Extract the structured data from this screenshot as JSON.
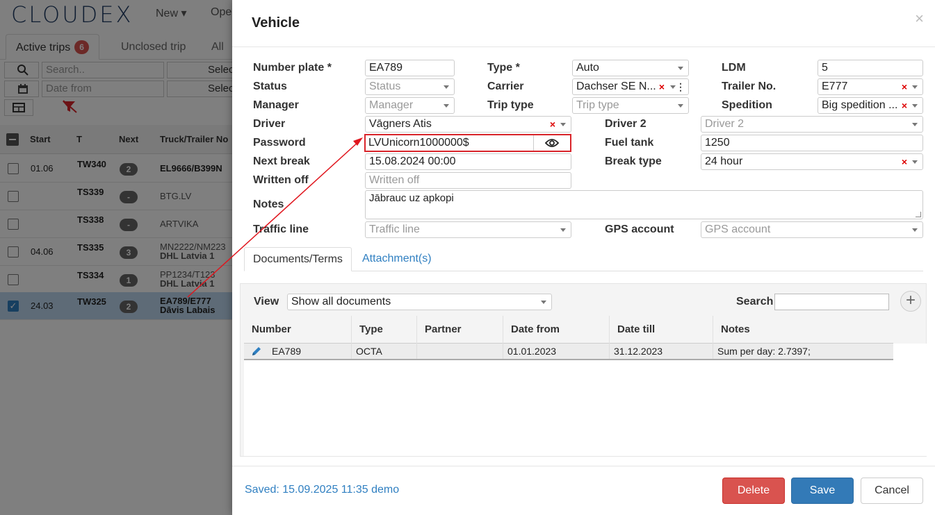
{
  "app": {
    "logo": "CLOUDEX",
    "nav": [
      "New ▾",
      "Ope"
    ],
    "tabs": {
      "active_label": "Active trips",
      "active_count": "6",
      "unclosed_label": "Unclosed trip",
      "all_label": "All t"
    },
    "filters": {
      "search_placeholder": "Search..",
      "date_placeholder": "Date from",
      "select1": "Selec",
      "select2": "Selec"
    },
    "table_headers": [
      "Start",
      "T",
      "Next",
      "Truck/Trailer No"
    ],
    "rows": [
      {
        "date": "01.06",
        "trip": "TW340",
        "count": "2",
        "truck": "EL9666/B399N",
        "truck2": ""
      },
      {
        "date": "",
        "trip": "TS339",
        "count": "-",
        "truck": "BTG.LV",
        "truck2": ""
      },
      {
        "date": "",
        "trip": "TS338",
        "count": "-",
        "truck": "ARTVIKA",
        "truck2": ""
      },
      {
        "date": "04.06",
        "trip": "TS335",
        "count": "3",
        "truck": "MN2222/NM223",
        "truck2": "DHL Latvia 1"
      },
      {
        "date": "",
        "trip": "TS334",
        "count": "1",
        "truck": "PP1234/T123",
        "truck2": "DHL Latvia 1"
      },
      {
        "date": "24.03",
        "trip": "TW325",
        "count": "2",
        "truck": "EA789/E777",
        "truck2": "Dāvis Labais"
      }
    ]
  },
  "modal": {
    "title": "Vehicle",
    "close": "×",
    "labels": {
      "number_plate": "Number plate *",
      "status": "Status",
      "manager": "Manager",
      "driver": "Driver",
      "password": "Password",
      "next_break": "Next break",
      "written_off": "Written off",
      "notes": "Notes",
      "traffic_line": "Traffic line",
      "type": "Type *",
      "carrier": "Carrier",
      "trip_type": "Trip type",
      "ldm": "LDM",
      "trailer_no": "Trailer No.",
      "spedition": "Spedition",
      "driver2": "Driver 2",
      "fuel_tank": "Fuel tank",
      "break_type": "Break type",
      "gps_account": "GPS account"
    },
    "values": {
      "number_plate": "EA789",
      "status_ph": "Status",
      "manager_ph": "Manager",
      "driver": "Vāgners Atis",
      "password": "LVUnicorn1000000$",
      "next_break": "15.08.2024 00:00",
      "written_off_ph": "Written off",
      "notes": "Jābrauc uz apkopi",
      "traffic_line_ph": "Traffic line",
      "type": "Auto",
      "carrier": "Dachser SE N...",
      "trip_type_ph": "Trip type",
      "ldm": "5",
      "trailer_no": "E777",
      "spedition": "Big spedition ...",
      "driver2_ph": "Driver 2",
      "fuel_tank": "1250",
      "break_type": "24 hour",
      "gps_account_ph": "GPS account"
    },
    "tabs": {
      "documents": "Documents/Terms",
      "attachments": "Attachment(s)"
    },
    "docs": {
      "view_label": "View",
      "view_value": "Show all documents",
      "search_label": "Search",
      "columns": [
        "Number",
        "Type",
        "Partner",
        "Date from",
        "Date till",
        "Notes"
      ],
      "rows": [
        {
          "number": "EA789",
          "type": "OCTA",
          "partner": "",
          "date_from": "01.01.2023",
          "date_till": "31.12.2023",
          "notes": "Sum per day: 2.7397;"
        }
      ]
    },
    "footer": {
      "saved": "Saved: 15.09.2025 11:35 demo",
      "delete": "Delete",
      "save": "Save",
      "cancel": "Cancel"
    }
  },
  "colors": {
    "accent": "#337ab7",
    "danger": "#d9534f",
    "highlight": "#d9242a"
  }
}
